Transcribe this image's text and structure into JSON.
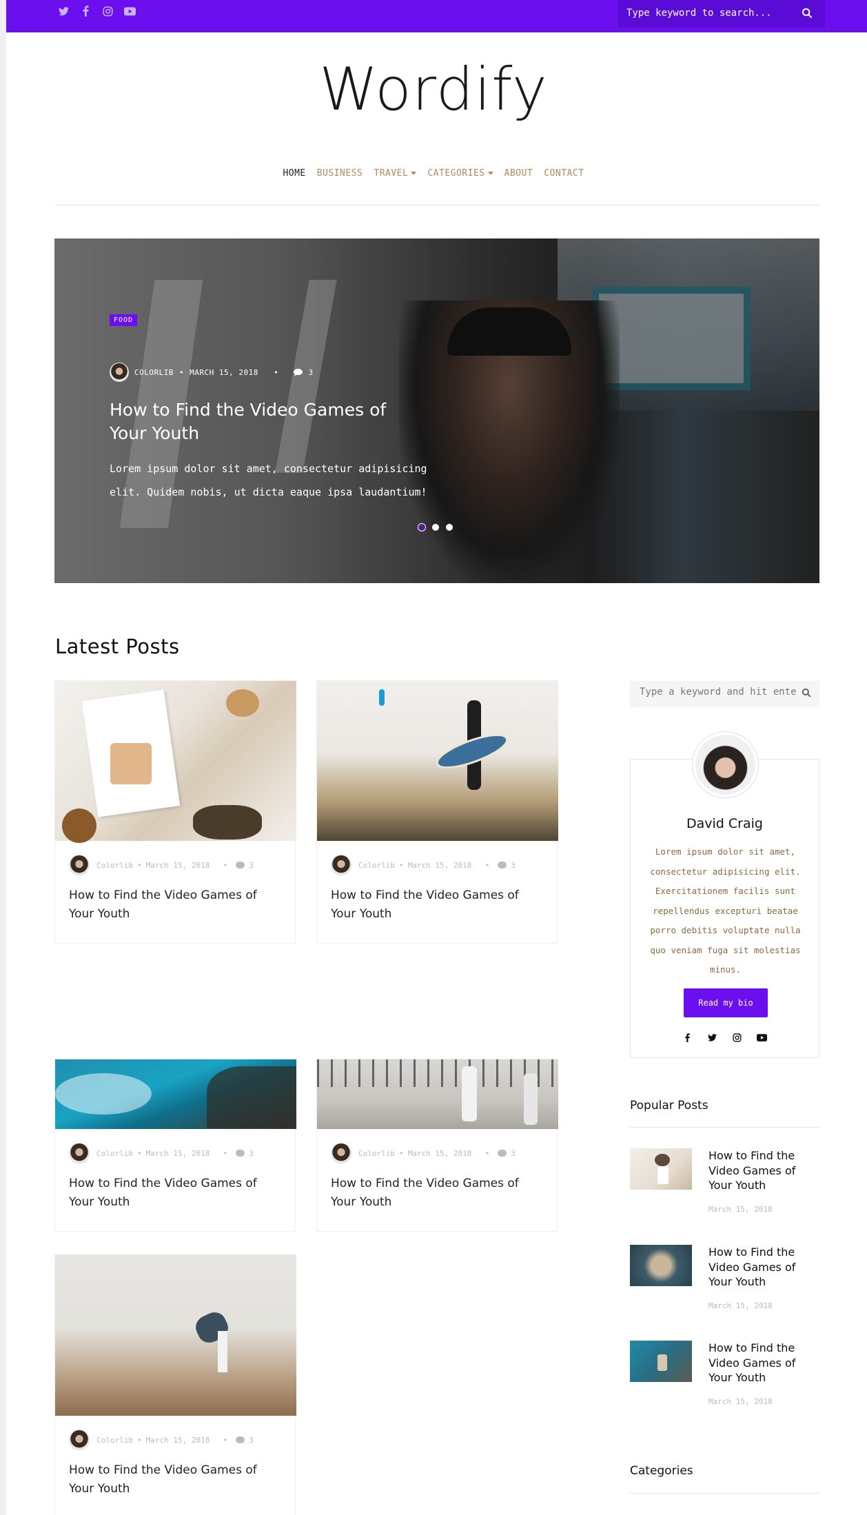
{
  "topbar": {
    "social_icons": [
      "twitter-icon",
      "facebook-icon",
      "instagram-icon",
      "youtube-icon"
    ],
    "search_placeholder": "Type keyword to search...",
    "accent_color": "#6c0fee"
  },
  "logo": "Wordify",
  "nav": {
    "items": [
      {
        "label": "HOME",
        "active": true,
        "dropdown": false
      },
      {
        "label": "BUSINESS",
        "active": false,
        "dropdown": false
      },
      {
        "label": "TRAVEL",
        "active": false,
        "dropdown": true
      },
      {
        "label": "CATEGORIES",
        "active": false,
        "dropdown": true
      },
      {
        "label": "ABOUT",
        "active": false,
        "dropdown": false
      },
      {
        "label": "CONTACT",
        "active": false,
        "dropdown": false
      }
    ]
  },
  "hero": {
    "tag": "FOOD",
    "author": "COLORLIB",
    "date": "MARCH 15, 2018",
    "comments": "3",
    "title": "How to Find the Video Games of Your Youth",
    "excerpt": "Lorem ipsum dolor sit amet, consectetur adipisicing elit. Quidem nobis, ut dicta eaque ipsa laudantium!",
    "slides": 3,
    "active_slide": 1
  },
  "latest": {
    "title": "Latest Posts",
    "posts": [
      {
        "author": "Colorlib",
        "date": "March 15, 2018",
        "comments": "3",
        "title": "How to Find the Video Games of Your Youth"
      },
      {
        "author": "Colorlib",
        "date": "March 15, 2018",
        "comments": "3",
        "title": "How to Find the Video Games of Your Youth"
      },
      {
        "author": "Colorlib",
        "date": "March 15, 2018",
        "comments": "3",
        "title": "How to Find the Video Games of Your Youth"
      },
      {
        "author": "Colorlib",
        "date": "March 15, 2018",
        "comments": "3",
        "title": "How to Find the Video Games of Your Youth"
      },
      {
        "author": "Colorlib",
        "date": "March 15, 2018",
        "comments": "3",
        "title": "How to Find the Video Games of Your Youth"
      }
    ]
  },
  "sidebar": {
    "search_placeholder": "Type a keyword and hit enter",
    "bio": {
      "name": "David Craig",
      "text": "Lorem ipsum dolor sit amet, consectetur adipisicing elit. Exercitationem facilis sunt repellendus excepturi beatae porro debitis voluptate nulla quo veniam fuga sit molestias minus.",
      "button": "Read my bio",
      "social_icons": [
        "facebook-icon",
        "twitter-icon",
        "instagram-icon",
        "youtube-icon"
      ]
    },
    "popular_title": "Popular Posts",
    "popular": [
      {
        "title": "How to Find the Video Games of Your Youth",
        "date": "March 15, 2018"
      },
      {
        "title": "How to Find the Video Games of Your Youth",
        "date": "March 15, 2018"
      },
      {
        "title": "How to Find the Video Games of Your Youth",
        "date": "March 15, 2018"
      }
    ],
    "categories_title": "Categories"
  }
}
